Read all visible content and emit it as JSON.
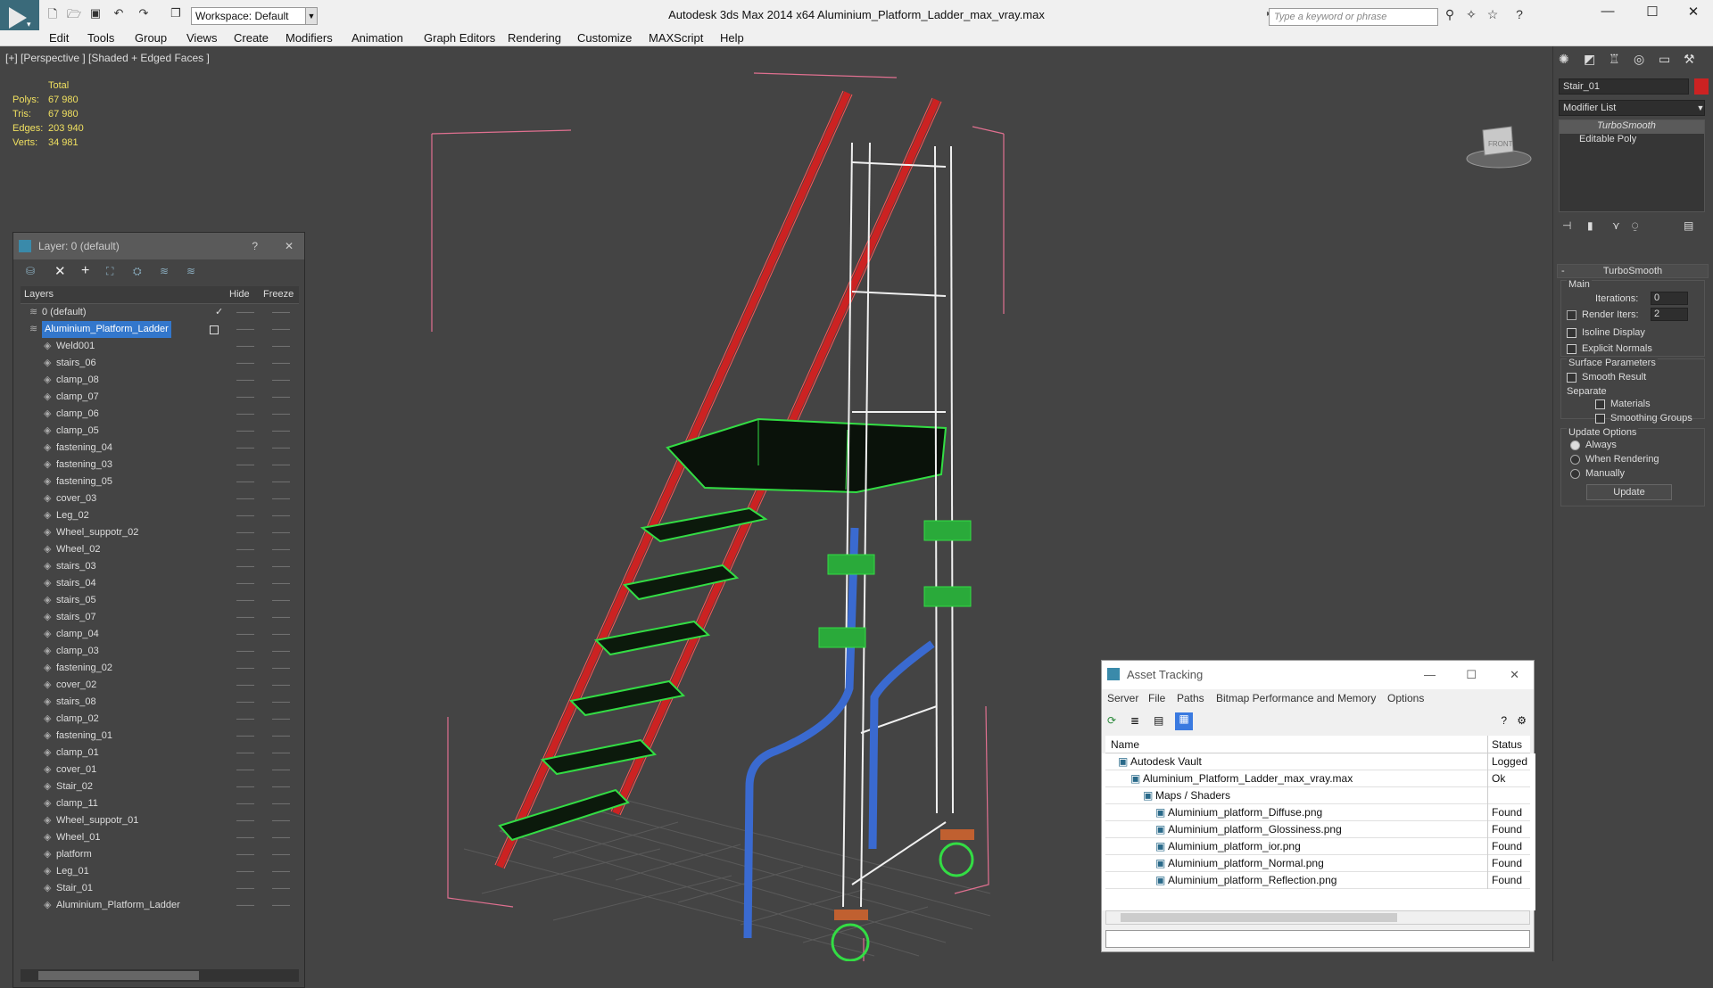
{
  "titlebar": {
    "workspace": "Workspace: Default",
    "app_title": "Autodesk 3ds Max  2014 x64     Aluminium_Platform_Ladder_max_vray.max",
    "search_placeholder": "Type a keyword or phrase",
    "min": "—",
    "max": "☐",
    "close": "✕"
  },
  "menu": [
    "Edit",
    "Tools",
    "Group",
    "Views",
    "Create",
    "Modifiers",
    "Animation",
    "Graph Editors",
    "Rendering",
    "Customize",
    "MAXScript",
    "Help"
  ],
  "viewport": {
    "label": "[+] [Perspective ] [Shaded + Edged Faces ]",
    "stats": {
      "total": "Total",
      "polys_label": "Polys:",
      "polys": "67 980",
      "tris_label": "Tris:",
      "tris": "67 980",
      "edges_label": "Edges:",
      "edges": "203 940",
      "verts_label": "Verts:",
      "verts": "34 981"
    }
  },
  "layer_panel": {
    "title": "Layer: 0 (default)",
    "help": "?",
    "close": "✕",
    "col_layers": "Layers",
    "col_hide": "Hide",
    "col_freeze": "Freeze",
    "items": [
      "0 (default)",
      "Aluminium_Platform_Ladder",
      "Weld001",
      "stairs_06",
      "clamp_08",
      "clamp_07",
      "clamp_06",
      "clamp_05",
      "fastening_04",
      "fastening_03",
      "fastening_05",
      "cover_03",
      "Leg_02",
      "Wheel_suppotr_02",
      "Wheel_02",
      "stairs_03",
      "stairs_04",
      "stairs_05",
      "stairs_07",
      "clamp_04",
      "clamp_03",
      "fastening_02",
      "cover_02",
      "stairs_08",
      "clamp_02",
      "fastening_01",
      "clamp_01",
      "cover_01",
      "Stair_02",
      "clamp_11",
      "Wheel_suppotr_01",
      "Wheel_01",
      "platform",
      "Leg_01",
      "Stair_01",
      "Aluminium_Platform_Ladder"
    ]
  },
  "command_panel": {
    "object_name": "Stair_01",
    "modifier_list": "Modifier List",
    "stack": [
      "TurboSmooth",
      "Editable Poly"
    ],
    "rollout_title": "TurboSmooth",
    "main": "Main",
    "iterations_label": "Iterations:",
    "iterations": "0",
    "render_iters_label": "Render Iters:",
    "render_iters": "2",
    "isoline": "Isoline Display",
    "explicit_normals": "Explicit Normals",
    "surface_params": "Surface Parameters",
    "smooth_result": "Smooth Result",
    "separate": "Separate",
    "materials": "Materials",
    "smoothing_groups": "Smoothing Groups",
    "update_options": "Update Options",
    "always": "Always",
    "when_rendering": "When Rendering",
    "manually": "Manually",
    "update_btn": "Update"
  },
  "asset_tracking": {
    "title": "Asset Tracking",
    "menu": [
      "Server",
      "File",
      "Paths",
      "Bitmap Performance and Memory",
      "Options"
    ],
    "col_name": "Name",
    "col_status": "Status",
    "rows": [
      {
        "name": "Autodesk Vault",
        "status": "Logged O",
        "indent": 1
      },
      {
        "name": "Aluminium_Platform_Ladder_max_vray.max",
        "status": "Ok",
        "indent": 2
      },
      {
        "name": "Maps / Shaders",
        "status": "",
        "indent": 3
      },
      {
        "name": "Aluminium_platform_Diffuse.png",
        "status": "Found",
        "indent": 4
      },
      {
        "name": "Aluminium_platform_Glossiness.png",
        "status": "Found",
        "indent": 4
      },
      {
        "name": "Aluminium_platform_ior.png",
        "status": "Found",
        "indent": 4
      },
      {
        "name": "Aluminium_platform_Normal.png",
        "status": "Found",
        "indent": 4
      },
      {
        "name": "Aluminium_platform_Reflection.png",
        "status": "Found",
        "indent": 4
      }
    ]
  },
  "colors": {
    "accent": "#3399ff",
    "wire_red": "#cc2222",
    "wire_green": "#33dd44",
    "wire_white": "#f0f0f0",
    "wire_blue": "#3a6ad0",
    "bbox_pink": "#e07090"
  }
}
